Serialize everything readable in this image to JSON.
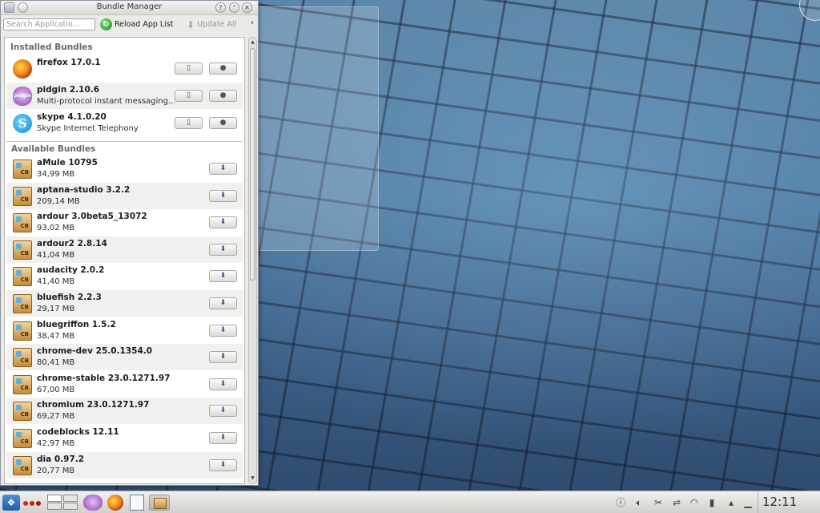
{
  "window": {
    "title": "Bundle Manager"
  },
  "toolbar": {
    "search_placeholder": "Search Applicatio...",
    "reload_label": "Reload App List",
    "update_label": "Update All",
    "more_label": "›"
  },
  "installed": {
    "header": "Installed Bundles",
    "items": [
      {
        "name": "firefox 17.0.1",
        "sub": "",
        "icon": "firefox-icon"
      },
      {
        "name": "pidgin 2.10.6",
        "sub": "Multi-protocol instant messaging...",
        "icon": "pidgin-icon"
      },
      {
        "name": "skype 4.1.0.20",
        "sub": "Skype Internet Telephony",
        "icon": "skype-icon"
      }
    ]
  },
  "available": {
    "header": "Available Bundles",
    "items": [
      {
        "name": "aMule 10795",
        "sub": "34,99 MB"
      },
      {
        "name": "aptana-studio 3.2.2",
        "sub": "209,14 MB"
      },
      {
        "name": "ardour 3.0beta5_13072",
        "sub": "93,02 MB"
      },
      {
        "name": "ardour2 2.8.14",
        "sub": "41,04 MB"
      },
      {
        "name": "audacity 2.0.2",
        "sub": "41,40 MB"
      },
      {
        "name": "bluefish 2.2.3",
        "sub": "29,17 MB"
      },
      {
        "name": "bluegriffon 1.5.2",
        "sub": "38,47 MB"
      },
      {
        "name": "chrome-dev 25.0.1354.0",
        "sub": "80,41 MB"
      },
      {
        "name": "chrome-stable 23.0.1271.97",
        "sub": "67,00 MB"
      },
      {
        "name": "chromium 23.0.1271.97",
        "sub": "69,27 MB"
      },
      {
        "name": "codeblocks 12.11",
        "sub": "42,97 MB"
      },
      {
        "name": "dia 0.97.2",
        "sub": "20,77 MB"
      }
    ]
  },
  "icons": {
    "bundle_icon_text": "CB",
    "pidgin_icon_text": "pidgin",
    "skype_icon_text": "S"
  },
  "taskbar": {
    "clock": "12:11"
  },
  "colors": {
    "install_button_accent": "#2a4f8f",
    "reload_icon": "#1d8b24"
  }
}
